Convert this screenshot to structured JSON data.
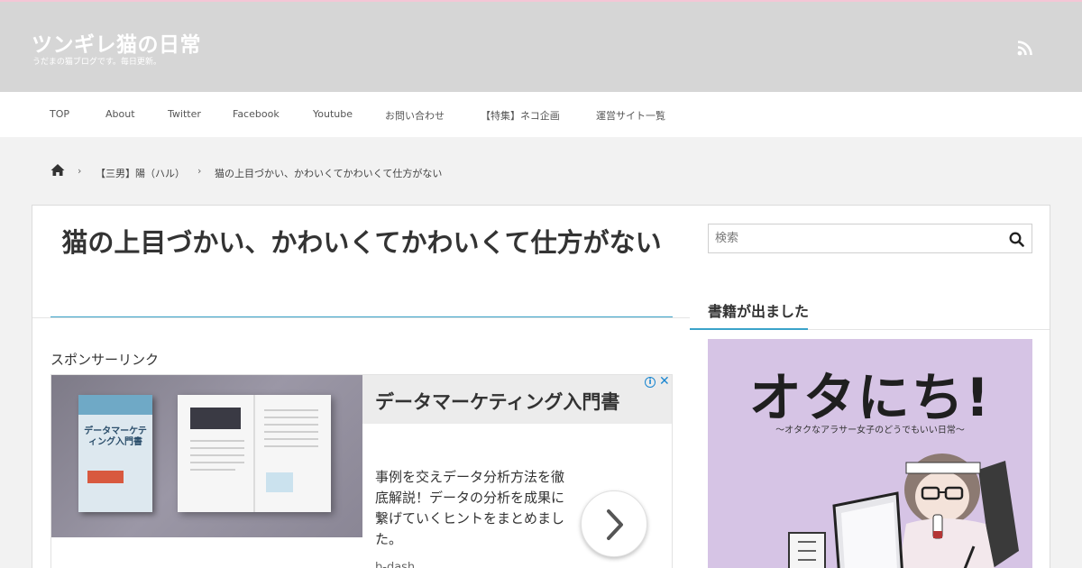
{
  "header": {
    "site_title": "ツンギレ猫の日常",
    "site_description": "うだまの猫ブログです。毎日更新。",
    "rss_icon": "rss-icon",
    "background": "#d6d6d6",
    "accent_top": "#f4c6d6"
  },
  "nav": {
    "items": [
      {
        "label": "TOP"
      },
      {
        "label": "About"
      },
      {
        "label": "Twitter"
      },
      {
        "label": "Facebook"
      },
      {
        "label": "Youtube"
      },
      {
        "label": "お問い合わせ"
      },
      {
        "label": "【特集】ネコ企画"
      },
      {
        "label": "運営サイト一覧"
      }
    ]
  },
  "breadcrumb": {
    "home_icon": "home-icon",
    "items": [
      "【三男】陽（ハル）",
      "猫の上目づかい、かわいくてかわいくて仕方がない"
    ],
    "separator": "›"
  },
  "article": {
    "title": "猫の上目づかい、かわいくてかわいくて仕方がない",
    "accent_color": "#3ba3c9",
    "sponsor_label": "スポンサーリンク"
  },
  "ad": {
    "headline": "データマーケティング入門書",
    "body": "事例を交えデータ分析方法を徹底解説！データの分析を成果に繋げていくヒントをまとめました。",
    "brand": "b-dash",
    "book_cover_text": "データマーケティング入門書",
    "info_icon": "info-icon",
    "close_icon": "close-icon",
    "arrow_icon": "chevron-right-icon"
  },
  "sidebar": {
    "search_placeholder": "検索",
    "search_icon": "search-icon",
    "widget_title": "書籍が出ました",
    "book_logo": "オタにち!",
    "book_subtitle": "〜オタクなアラサー女子のどうでもいい日常〜"
  }
}
